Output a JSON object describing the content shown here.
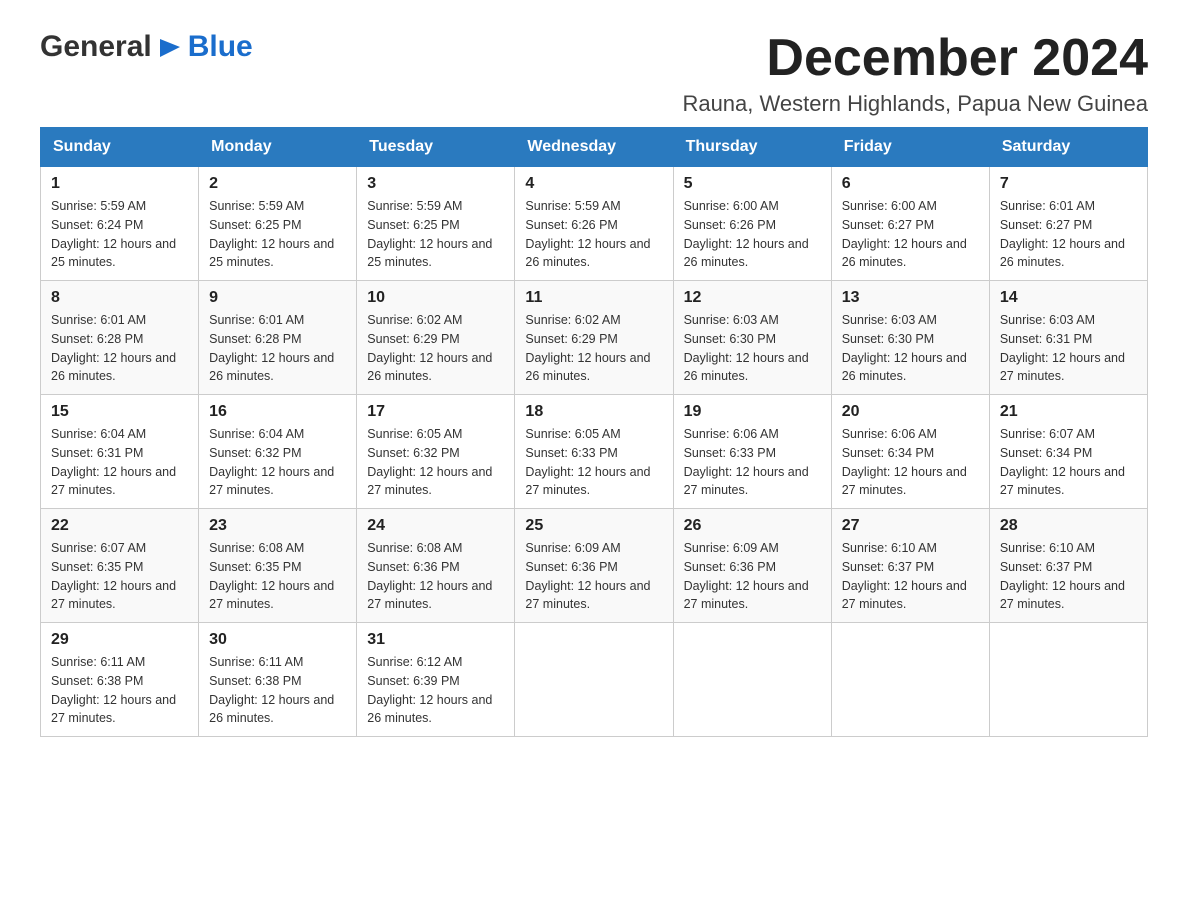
{
  "header": {
    "logo_general": "General",
    "logo_blue": "Blue",
    "month_title": "December 2024",
    "location": "Rauna, Western Highlands, Papua New Guinea"
  },
  "weekdays": [
    "Sunday",
    "Monday",
    "Tuesday",
    "Wednesday",
    "Thursday",
    "Friday",
    "Saturday"
  ],
  "weeks": [
    [
      {
        "day": "1",
        "sunrise": "5:59 AM",
        "sunset": "6:24 PM",
        "daylight": "12 hours and 25 minutes."
      },
      {
        "day": "2",
        "sunrise": "5:59 AM",
        "sunset": "6:25 PM",
        "daylight": "12 hours and 25 minutes."
      },
      {
        "day": "3",
        "sunrise": "5:59 AM",
        "sunset": "6:25 PM",
        "daylight": "12 hours and 25 minutes."
      },
      {
        "day": "4",
        "sunrise": "5:59 AM",
        "sunset": "6:26 PM",
        "daylight": "12 hours and 26 minutes."
      },
      {
        "day": "5",
        "sunrise": "6:00 AM",
        "sunset": "6:26 PM",
        "daylight": "12 hours and 26 minutes."
      },
      {
        "day": "6",
        "sunrise": "6:00 AM",
        "sunset": "6:27 PM",
        "daylight": "12 hours and 26 minutes."
      },
      {
        "day": "7",
        "sunrise": "6:01 AM",
        "sunset": "6:27 PM",
        "daylight": "12 hours and 26 minutes."
      }
    ],
    [
      {
        "day": "8",
        "sunrise": "6:01 AM",
        "sunset": "6:28 PM",
        "daylight": "12 hours and 26 minutes."
      },
      {
        "day": "9",
        "sunrise": "6:01 AM",
        "sunset": "6:28 PM",
        "daylight": "12 hours and 26 minutes."
      },
      {
        "day": "10",
        "sunrise": "6:02 AM",
        "sunset": "6:29 PM",
        "daylight": "12 hours and 26 minutes."
      },
      {
        "day": "11",
        "sunrise": "6:02 AM",
        "sunset": "6:29 PM",
        "daylight": "12 hours and 26 minutes."
      },
      {
        "day": "12",
        "sunrise": "6:03 AM",
        "sunset": "6:30 PM",
        "daylight": "12 hours and 26 minutes."
      },
      {
        "day": "13",
        "sunrise": "6:03 AM",
        "sunset": "6:30 PM",
        "daylight": "12 hours and 26 minutes."
      },
      {
        "day": "14",
        "sunrise": "6:03 AM",
        "sunset": "6:31 PM",
        "daylight": "12 hours and 27 minutes."
      }
    ],
    [
      {
        "day": "15",
        "sunrise": "6:04 AM",
        "sunset": "6:31 PM",
        "daylight": "12 hours and 27 minutes."
      },
      {
        "day": "16",
        "sunrise": "6:04 AM",
        "sunset": "6:32 PM",
        "daylight": "12 hours and 27 minutes."
      },
      {
        "day": "17",
        "sunrise": "6:05 AM",
        "sunset": "6:32 PM",
        "daylight": "12 hours and 27 minutes."
      },
      {
        "day": "18",
        "sunrise": "6:05 AM",
        "sunset": "6:33 PM",
        "daylight": "12 hours and 27 minutes."
      },
      {
        "day": "19",
        "sunrise": "6:06 AM",
        "sunset": "6:33 PM",
        "daylight": "12 hours and 27 minutes."
      },
      {
        "day": "20",
        "sunrise": "6:06 AM",
        "sunset": "6:34 PM",
        "daylight": "12 hours and 27 minutes."
      },
      {
        "day": "21",
        "sunrise": "6:07 AM",
        "sunset": "6:34 PM",
        "daylight": "12 hours and 27 minutes."
      }
    ],
    [
      {
        "day": "22",
        "sunrise": "6:07 AM",
        "sunset": "6:35 PM",
        "daylight": "12 hours and 27 minutes."
      },
      {
        "day": "23",
        "sunrise": "6:08 AM",
        "sunset": "6:35 PM",
        "daylight": "12 hours and 27 minutes."
      },
      {
        "day": "24",
        "sunrise": "6:08 AM",
        "sunset": "6:36 PM",
        "daylight": "12 hours and 27 minutes."
      },
      {
        "day": "25",
        "sunrise": "6:09 AM",
        "sunset": "6:36 PM",
        "daylight": "12 hours and 27 minutes."
      },
      {
        "day": "26",
        "sunrise": "6:09 AM",
        "sunset": "6:36 PM",
        "daylight": "12 hours and 27 minutes."
      },
      {
        "day": "27",
        "sunrise": "6:10 AM",
        "sunset": "6:37 PM",
        "daylight": "12 hours and 27 minutes."
      },
      {
        "day": "28",
        "sunrise": "6:10 AM",
        "sunset": "6:37 PM",
        "daylight": "12 hours and 27 minutes."
      }
    ],
    [
      {
        "day": "29",
        "sunrise": "6:11 AM",
        "sunset": "6:38 PM",
        "daylight": "12 hours and 27 minutes."
      },
      {
        "day": "30",
        "sunrise": "6:11 AM",
        "sunset": "6:38 PM",
        "daylight": "12 hours and 26 minutes."
      },
      {
        "day": "31",
        "sunrise": "6:12 AM",
        "sunset": "6:39 PM",
        "daylight": "12 hours and 26 minutes."
      },
      null,
      null,
      null,
      null
    ]
  ],
  "labels": {
    "sunrise": "Sunrise:",
    "sunset": "Sunset:",
    "daylight": "Daylight:"
  }
}
